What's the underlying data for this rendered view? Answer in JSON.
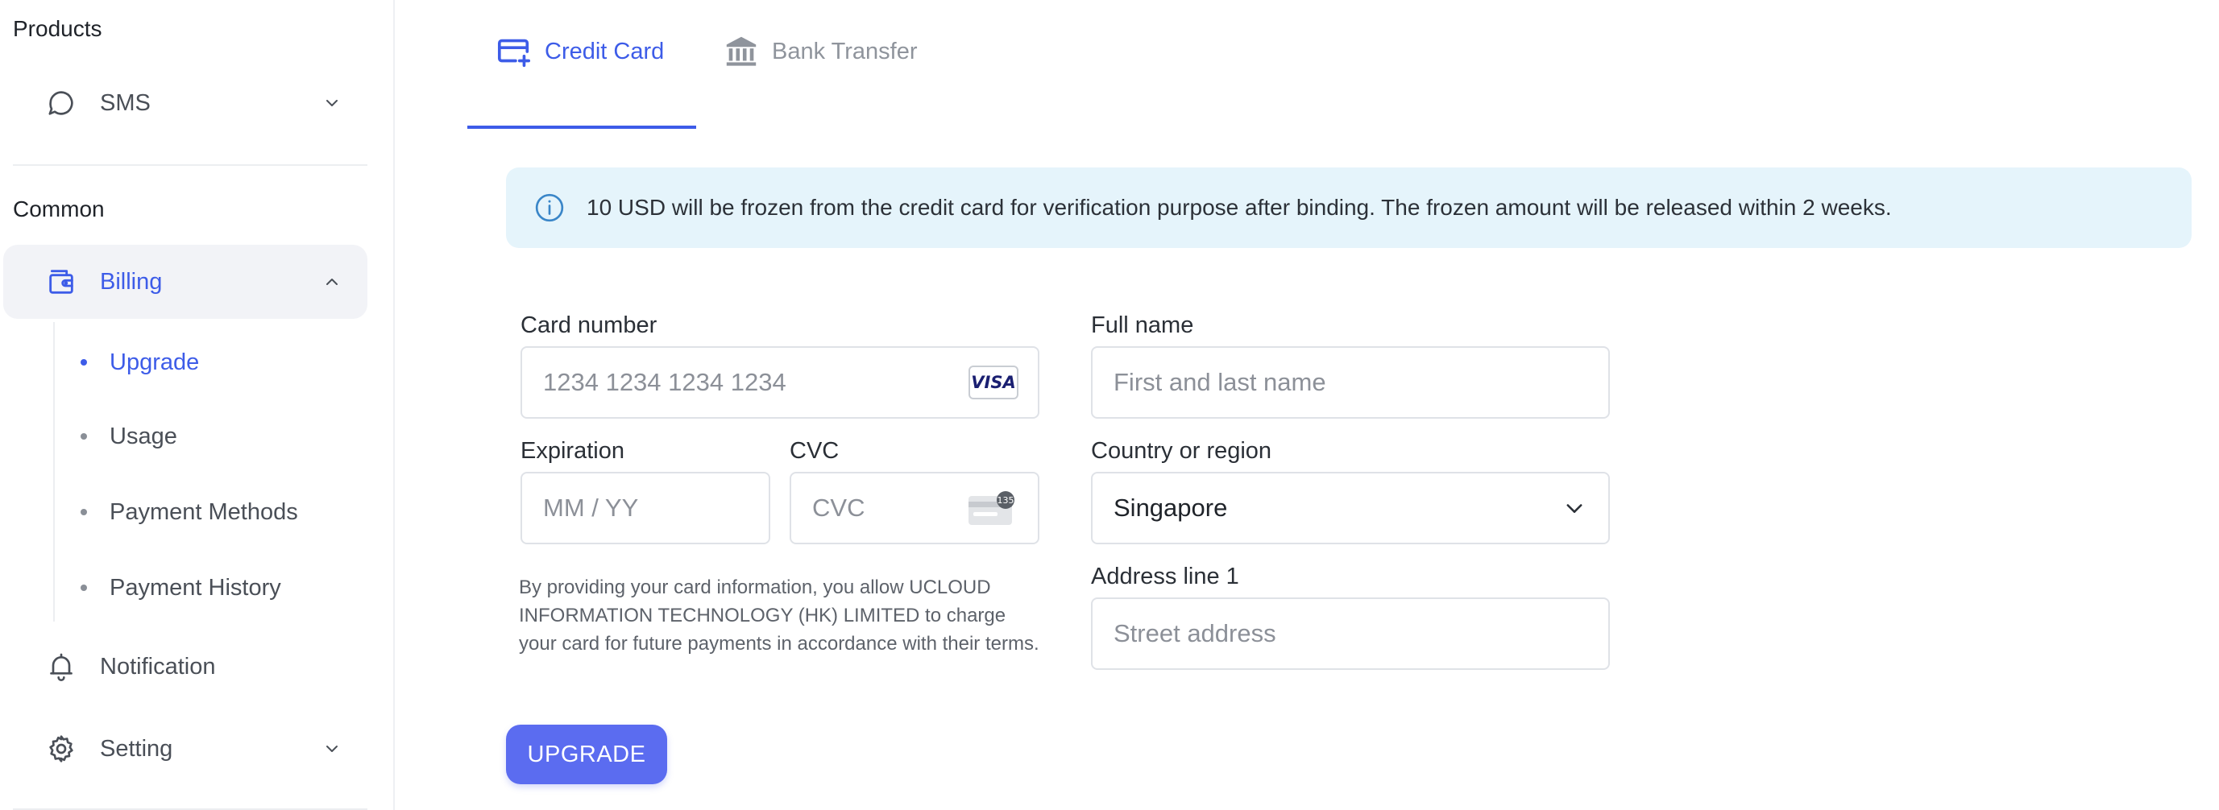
{
  "colors": {
    "accent": "#3d5ce8",
    "button": "#5b6cf0",
    "info_bg": "#e5f4fb",
    "active_nav_bg": "#f2f3f7"
  },
  "sidebar": {
    "products_title": "Products",
    "sms": {
      "label": "SMS",
      "icon": "chat-bubble-icon"
    },
    "common_title": "Common",
    "billing": {
      "label": "Billing",
      "icon": "wallet-icon",
      "expanded": true,
      "sub_items": [
        {
          "label": "Upgrade",
          "active": true
        },
        {
          "label": "Usage"
        },
        {
          "label": "Payment Methods"
        },
        {
          "label": "Payment History"
        }
      ]
    },
    "notification": {
      "label": "Notification",
      "icon": "bell-icon"
    },
    "setting": {
      "label": "Setting",
      "icon": "gear-icon"
    }
  },
  "tabs": [
    {
      "label": "Credit Card",
      "icon": "credit-card-add-icon",
      "active": true
    },
    {
      "label": "Bank Transfer",
      "icon": "bank-icon",
      "active": false
    }
  ],
  "info": {
    "text": "10 USD will be frozen from the credit card for verification purpose after binding. The frozen amount will be released within 2 weeks."
  },
  "form": {
    "card_number": {
      "label": "Card number",
      "placeholder": "1234 1234 1234 1234",
      "brand": "VISA"
    },
    "expiration": {
      "label": "Expiration",
      "placeholder": "MM / YY"
    },
    "cvc": {
      "label": "CVC",
      "placeholder": "CVC",
      "badge": "135"
    },
    "full_name": {
      "label": "Full name",
      "placeholder": "First and last name"
    },
    "country": {
      "label": "Country or region",
      "value": "Singapore"
    },
    "address": {
      "label": "Address line 1",
      "placeholder": "Street address"
    },
    "terms": "By providing your card information, you allow UCLOUD INFORMATION TECHNOLOGY (HK) LIMITED to charge your card for future payments in accordance with their terms.",
    "submit_label": "UPGRADE"
  }
}
